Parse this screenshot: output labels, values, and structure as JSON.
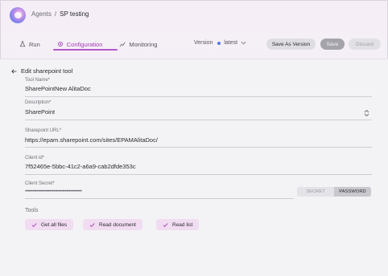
{
  "header": {
    "breadcrumb": [
      "Agents",
      "/",
      "SP testing"
    ]
  },
  "tabs": [
    {
      "label": "Run",
      "icon": "flask-icon",
      "active": false
    },
    {
      "label": "Configuration",
      "icon": "gear-icon",
      "active": true
    },
    {
      "label": "Monitoring",
      "icon": "chart-icon",
      "active": false
    }
  ],
  "version": {
    "label": "Version",
    "selected": "latest",
    "dot_color": "#4d7be8"
  },
  "actions": {
    "save_as_version": "Save As Version",
    "save": "Save",
    "discard": "Discard"
  },
  "form": {
    "back_label": "Edit sharepoint tool",
    "tool_name": {
      "label": "Tool Name*",
      "value": "SharePointNew AlitaDoc"
    },
    "description": {
      "label": "Description*",
      "value": "SharePoint"
    },
    "sharepoint_url": {
      "label": "Sharepoint URL*",
      "value": "https://epam.sharepoint.com/sites/EPAMAlitaDoc/"
    },
    "client_id": {
      "label": "Client id*",
      "value": "7f52465e-5bbc-41c2-a6a9-cab2dfde353c"
    },
    "client_secret": {
      "label": "Client Secret*",
      "value": "••••••••••••••••••••••••••••••••••••••••••••"
    },
    "secret_toggle": {
      "secret": "SECRET",
      "password": "PASSWORD",
      "selected": "PASSWORD"
    },
    "tools_label": "Tools",
    "tools": [
      "Get all files",
      "Read document",
      "Read list"
    ]
  },
  "colors": {
    "accent": "#a13bb7",
    "chip_bg": "#f1dcf1"
  }
}
